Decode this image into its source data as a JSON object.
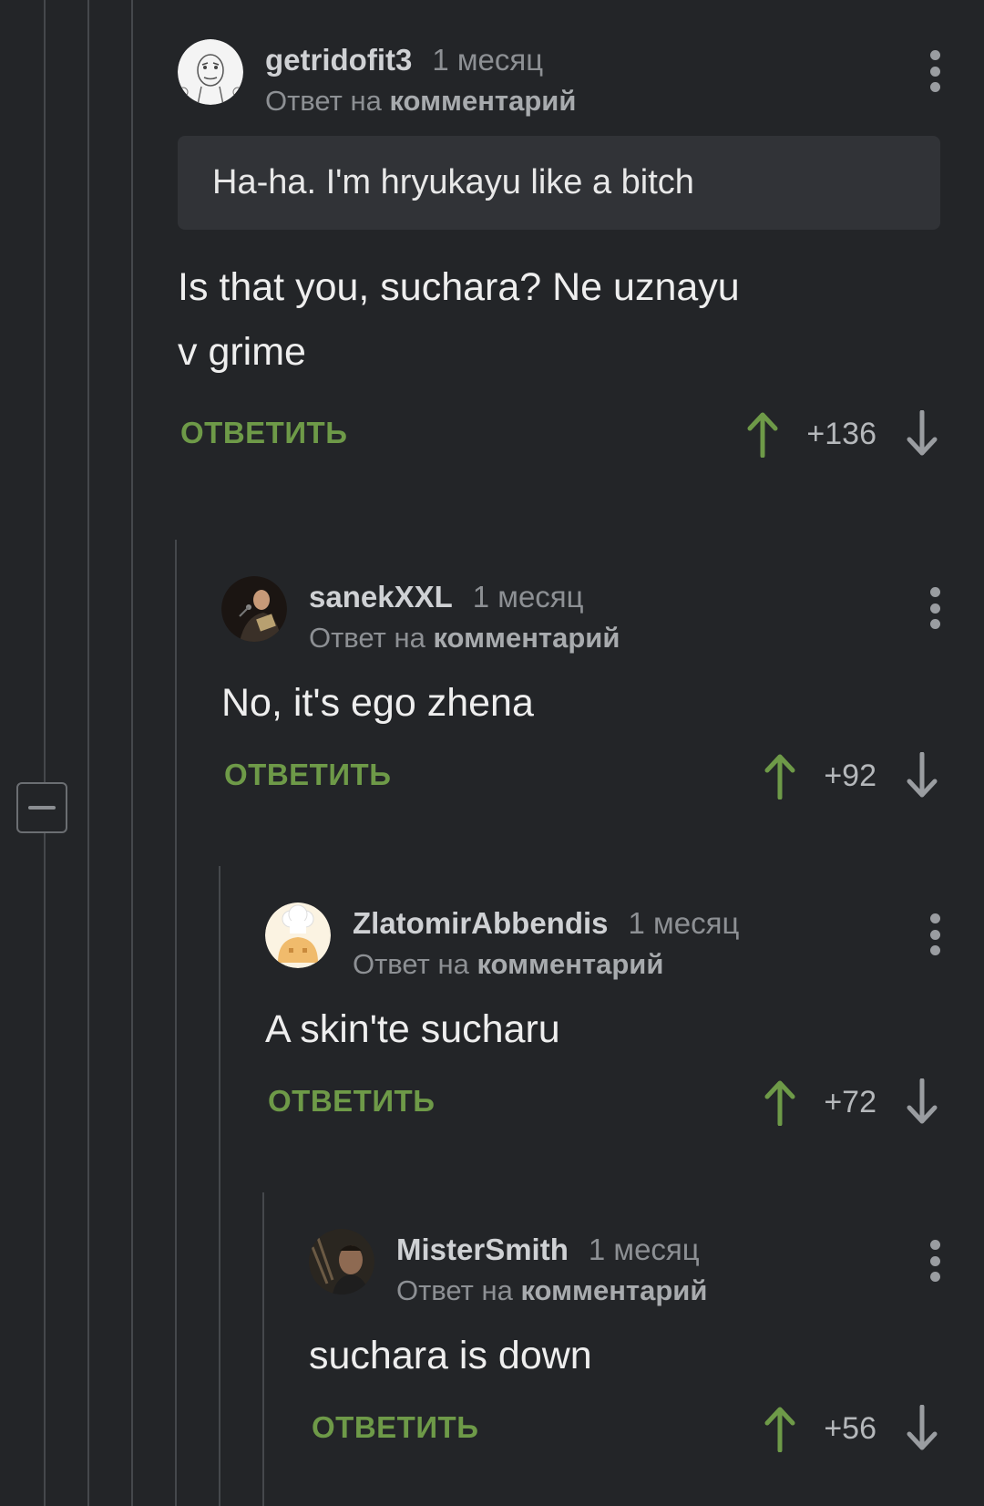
{
  "comments": [
    {
      "author": "getridofit3",
      "time": "1 месяц",
      "reply_prefix": "Ответ на",
      "reply_target": "комментарий",
      "quote": "Ha-ha. I'm hryukayu like a bitch",
      "text_lines": [
        "Is that you, suchara? Ne uznayu",
        "v grime"
      ],
      "reply_label": "ОТВЕТИТЬ",
      "score": "+136",
      "avatar_icon": "troll-face-avatar"
    },
    {
      "author": "sanekXXL",
      "time": "1 месяц",
      "reply_prefix": "Ответ на",
      "reply_target": "комментарий",
      "text_lines": [
        "No, it's ego zhena"
      ],
      "reply_label": "ОТВЕТИТЬ",
      "score": "+92",
      "avatar_icon": "singer-photo-avatar"
    },
    {
      "author": "ZlatomirAbbendis",
      "time": "1 месяц",
      "reply_prefix": "Ответ на",
      "reply_target": "комментарий",
      "text_lines": [
        "A skin'te sucharu"
      ],
      "reply_label": "ОТВЕТИТЬ",
      "score": "+72",
      "avatar_icon": "chef-hat-avatar"
    },
    {
      "author": "MisterSmith",
      "time": "1 месяц",
      "reply_prefix": "Ответ на",
      "reply_target": "комментарий",
      "text_lines": [
        "suchara is down"
      ],
      "reply_label": "ОТВЕТИТЬ",
      "score": "+56",
      "avatar_icon": "man-portrait-avatar"
    }
  ],
  "colors": {
    "background": "#232528",
    "accent_green": "#6e9a48",
    "thread_line": "#45484c"
  }
}
